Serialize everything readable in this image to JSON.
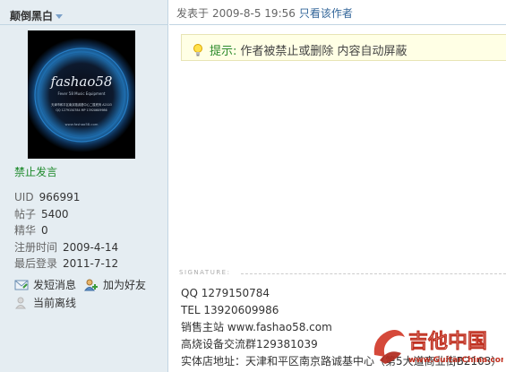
{
  "sidebar": {
    "author_name": "颠倒黑白",
    "avatar": {
      "brand": "fashao58",
      "tagline": "Fever 58 Music Equipment",
      "line1": "天津市和平区南京路诚基中心二楼底商 A2103",
      "line2": "QQ 1279150784   MP 13920609986",
      "site": "www.fashao58.com"
    },
    "status": "禁止发言",
    "stats": [
      {
        "label": "UID",
        "value": "966991"
      },
      {
        "label": "帖子",
        "value": "5400"
      },
      {
        "label": "精华",
        "value": "0"
      },
      {
        "label": "注册时间",
        "value": "2009-4-14"
      },
      {
        "label": "最后登录",
        "value": "2011-7-12"
      }
    ],
    "actions": {
      "message": "发短消息",
      "add_friend": "加为好友",
      "offline": "当前离线"
    }
  },
  "post": {
    "posted_prefix": "发表于",
    "posted_at": "2009-8-5 19:56",
    "author_only": "只看该作者",
    "notice_label": "提示:",
    "notice_text": "作者被禁止或删除 内容自动屏蔽",
    "signature_label": "SIGNATURE",
    "signature_lines": [
      "QQ  1279150784",
      "TEL  13920609986",
      "销售主站  www.fashao58.com",
      "高烧设备交流群129381039",
      "实体店地址：天津和平区南京路诚基中心（第5大道商业街B2103）"
    ]
  },
  "watermark": {
    "name": "吉他中国",
    "url": "www.GuitarChina.com"
  },
  "colors": {
    "sidebar_bg": "#E5EDF2",
    "border": "#C2D5E3",
    "link": "#336699",
    "banned_green": "#1e8a2c",
    "notice_bg": "#FFFFE5",
    "watermark_red": "#d23a2a"
  },
  "icons": {
    "author_menu": "chevron-down-icon",
    "message": "mail-icon",
    "add_friend": "user-add-icon",
    "offline": "user-offline-icon",
    "notice": "lightbulb-icon"
  }
}
